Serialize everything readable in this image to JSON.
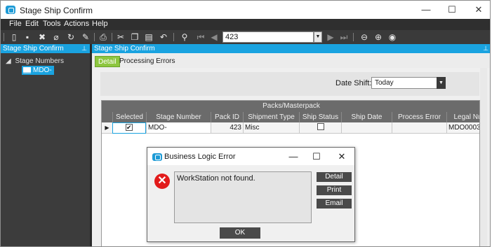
{
  "window": {
    "title": "Stage Ship Confirm",
    "minimize": "—",
    "maximize": "☐",
    "close": "✕"
  },
  "menu": [
    "File",
    "Edit",
    "Tools",
    "Actions",
    "Help"
  ],
  "navigator": {
    "value": "423"
  },
  "left_pane": {
    "header": "Stage Ship Confirm",
    "tree_root": "Stage Numbers",
    "tree_child": "MDO-"
  },
  "right_pane": {
    "header": "Stage Ship Confirm",
    "tabs": [
      "Detail",
      "Processing Errors"
    ],
    "active_tab": "Detail",
    "date_shift_label": "Date Shift:",
    "date_shift_value": "Today"
  },
  "grid": {
    "group_header": "Packs/Masterpack",
    "columns": [
      "Selected",
      "Stage Number",
      "Pack ID",
      "Shipment Type",
      "Ship Status",
      "Ship Date",
      "Process Error",
      "Legal Nu"
    ],
    "row": {
      "selected": true,
      "stage_number": "MDO-",
      "pack_id": "423",
      "shipment_type": "Misc",
      "ship_status": false,
      "ship_date": "",
      "process_error": "",
      "legal_number": "MDO0003"
    }
  },
  "dialog": {
    "title": "Business Logic Error",
    "message": "WorkStation not found.",
    "buttons": [
      "Detail",
      "Print",
      "Email"
    ],
    "ok": "OK"
  }
}
